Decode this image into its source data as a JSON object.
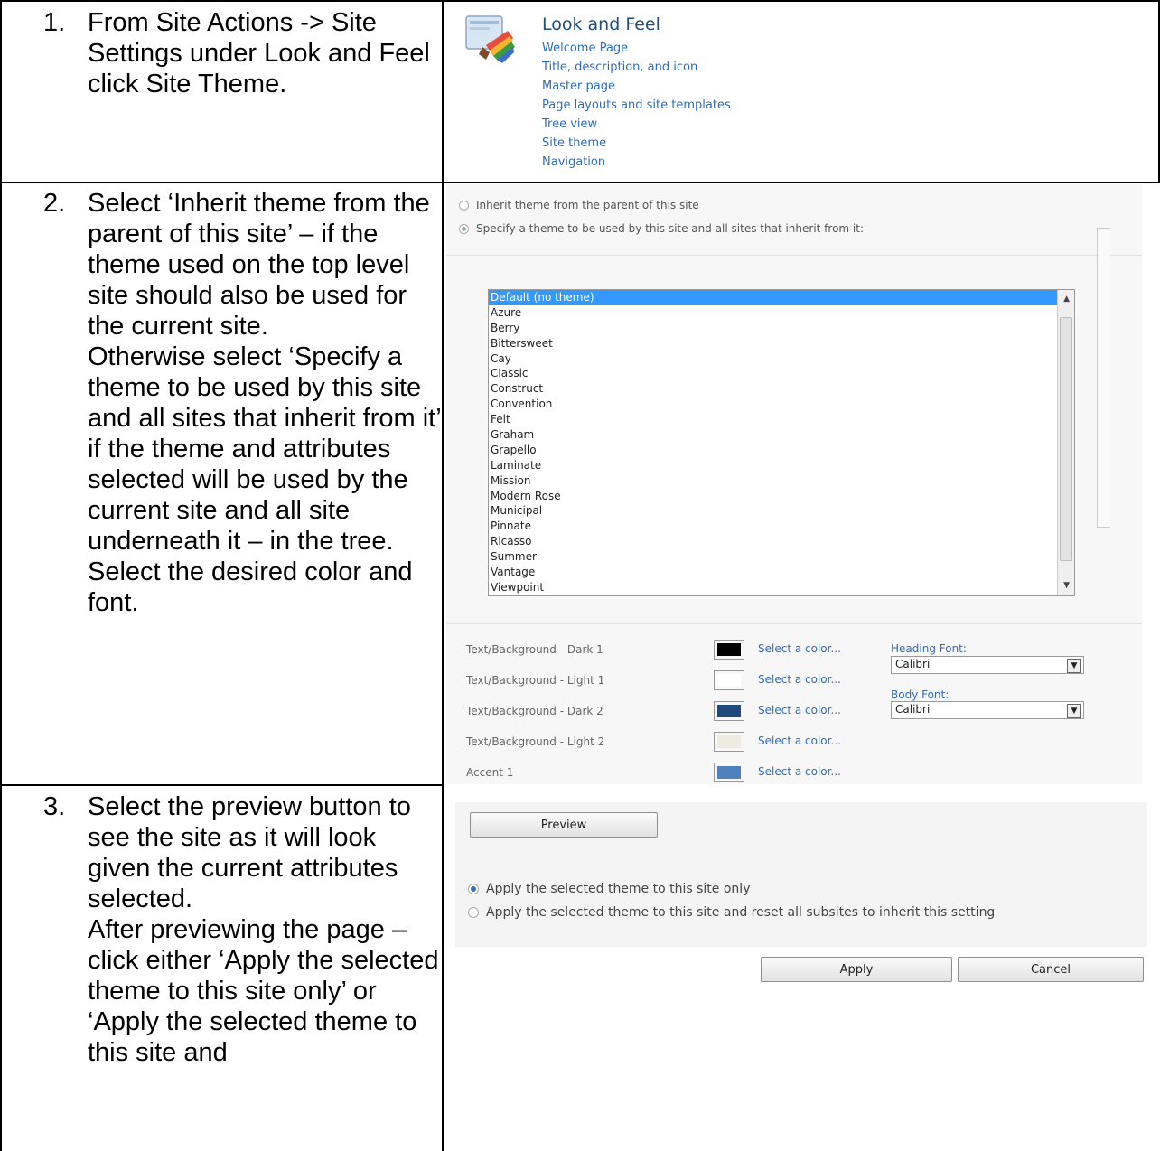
{
  "steps": [
    {
      "num": "1.",
      "text": "From Site Actions -> Site Settings under Look and Feel click Site Theme."
    },
    {
      "num": "2.",
      "text": "Select ‘Inherit theme from the parent of this site’ – if the theme used on the top level site should also be used for the current site.\nOtherwise select ‘Specify a theme to be used by this site and all sites that inherit from it’ if the theme and attributes selected will be used by the current site and all site underneath it – in the tree.\nSelect the desired color and font."
    },
    {
      "num": "3.",
      "text": "Select the preview button to see the site as it will look given the current attributes selected.\nAfter previewing the page – click either ‘Apply the selected theme to this site only’ or ‘Apply the selected theme to this site and"
    }
  ],
  "look_and_feel": {
    "title": "Look and Feel",
    "links": [
      "Welcome Page",
      "Title, description, and icon",
      "Master page",
      "Page layouts and site templates",
      "Tree view",
      "Site theme",
      "Navigation"
    ]
  },
  "theme_panel": {
    "radio_inherit": "Inherit theme from the parent of this site",
    "radio_specify": "Specify a theme to be used by this site and all sites that inherit from it:",
    "themes": [
      "Default (no theme)",
      "Azure",
      "Berry",
      "Bittersweet",
      "Cay",
      "Classic",
      "Construct",
      "Convention",
      "Felt",
      "Graham",
      "Grapello",
      "Laminate",
      "Mission",
      "Modern Rose",
      "Municipal",
      "Pinnate",
      "Ricasso",
      "Summer",
      "Vantage",
      "Viewpoint"
    ],
    "selected_theme": "Default (no theme)",
    "colors": [
      {
        "label": "Text/Background - Dark 1",
        "color": "#000000",
        "link": "Select a color..."
      },
      {
        "label": "Text/Background - Light 1",
        "color": "#ffffff",
        "link": "Select a color..."
      },
      {
        "label": "Text/Background - Dark 2",
        "color": "#1f497d",
        "link": "Select a color..."
      },
      {
        "label": "Text/Background - Light 2",
        "color": "#eeece1",
        "link": "Select a color..."
      },
      {
        "label": "Accent 1",
        "color": "#4f81bd",
        "link": "Select a color..."
      }
    ],
    "heading_font_label": "Heading Font:",
    "heading_font": "Calibri",
    "body_font_label": "Body Font:",
    "body_font": "Calibri"
  },
  "apply_panel": {
    "preview_button": "Preview",
    "radio_this_site": "Apply the selected theme to this site only",
    "radio_reset": "Apply the selected theme to this site and reset all subsites to inherit this setting",
    "apply_button": "Apply",
    "cancel_button": "Cancel"
  }
}
